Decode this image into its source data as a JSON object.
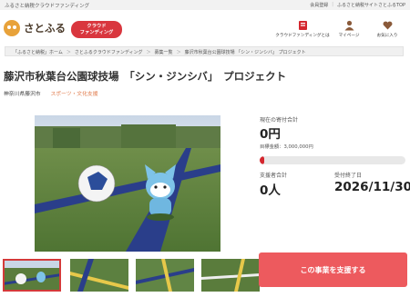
{
  "topbar": {
    "lead": "ふるさと納税クラウドファンディング",
    "links": [
      "会員登録",
      "ふるさと納税サイトさとふるTOP"
    ]
  },
  "header": {
    "logo_text": "さとふる",
    "badge_text": "クラウド\nファンディング",
    "nav": [
      {
        "label": "クラウドファンディングとは",
        "icon": "book-icon"
      },
      {
        "label": "マイページ",
        "icon": "user-icon"
      },
      {
        "label": "お気に入り",
        "icon": "heart-icon"
      }
    ]
  },
  "breadcrumb": [
    "「ふるさと納税」ホーム",
    "さとふるクラウドファンディング",
    "募集一覧",
    "藤沢市秋葉台公園球技場 「シン・ジンシバ」 プロジェクト"
  ],
  "project": {
    "title": "藤沢市秋葉台公園球技場　「シン・ジンシバ」　プロジェクト",
    "prefecture": "神奈川県藤沢市",
    "category": "スポーツ・文化支援"
  },
  "stats": {
    "donation_label": "現在の寄付合計",
    "donation_value": "0円",
    "goal_text": "目標金額：3,000,000円",
    "progress_fraction": 0.0,
    "supporters_label": "支援者合計",
    "supporters_value": "0人",
    "end_label": "受付終了日",
    "end_value": "2026/11/30"
  },
  "cta": {
    "label": "この事業を支援する"
  },
  "colors": {
    "accent": "#d4262e",
    "button": "#ed5a5e",
    "category": "#e07a4a"
  }
}
